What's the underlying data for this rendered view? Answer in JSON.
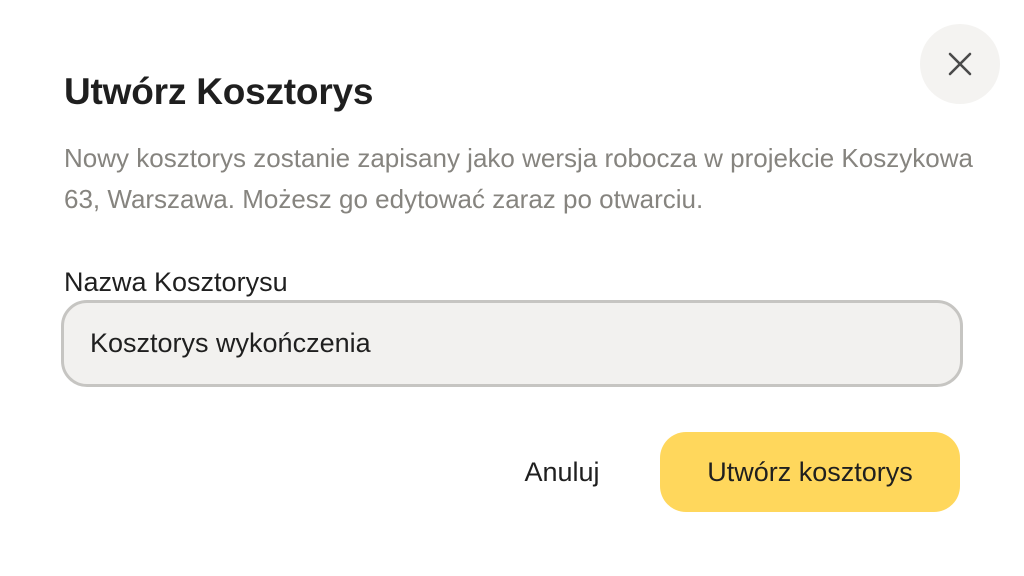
{
  "dialog": {
    "title": "Utwórz Kosztorys",
    "description": "Nowy kosztorys zostanie zapisany jako wersja robocza w projekcie Koszykowa 63, Warszawa. Możesz go edytować zaraz po otwarciu.",
    "close_icon": "close-icon"
  },
  "form": {
    "name_label": "Nazwa Kosztorysu",
    "name_value": "Kosztorys wykończenia"
  },
  "actions": {
    "cancel_label": "Anuluj",
    "create_label": "Utwórz kosztorys"
  },
  "colors": {
    "primary_button": "#ffd75c",
    "input_background": "#f2f1ef",
    "close_background": "#f4f3f1",
    "description_text": "#86847f",
    "text": "#1f1f1f"
  }
}
